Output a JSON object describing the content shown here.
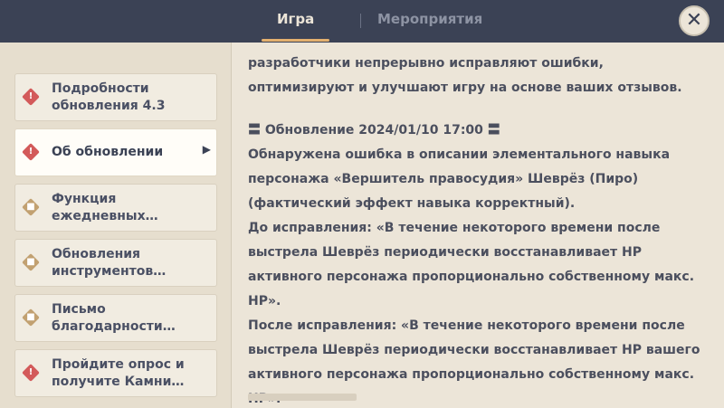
{
  "tabs": [
    {
      "label": "Игра",
      "active": true
    },
    {
      "label": "Мероприятия",
      "active": false
    }
  ],
  "close_icon": "close-icon",
  "sidebar": {
    "items": [
      {
        "label": "Подробности обновления 4.3",
        "icon": "alert-icon",
        "icon_color": "#d35a5a",
        "active": false
      },
      {
        "label": "Об обновлении",
        "icon": "alert-icon",
        "icon_color": "#d35a5a",
        "active": true
      },
      {
        "label": "Функция ежедневных…",
        "icon": "tag-icon",
        "icon_color": "#c2a171",
        "active": false
      },
      {
        "label": "Обновления инструментов…",
        "icon": "tag-icon",
        "icon_color": "#c2a171",
        "active": false
      },
      {
        "label": "Письмо благодарности…",
        "icon": "tag-icon",
        "icon_color": "#c2a171",
        "active": false
      },
      {
        "label": "Пройдите опрос и получите Камни…",
        "icon": "alert-icon",
        "icon_color": "#d35a5a",
        "active": false
      }
    ]
  },
  "content": {
    "intro": "разработчики непрерывно исправляют ошибки, оптимизируют и улучшают игру на основе ваших отзывов.",
    "heading": "〓 Обновление 2024/01/10 17:00 〓",
    "body_1": "Обнаружена ошибка в описании элементального навыка персонажа «Вершитель правосудия» Шеврёз (Пиро) (фактический эффект навыка корректный).",
    "body_2": "До исправления: «В течение некоторого времени после выстрела Шеврёз периодически восстанавливает HP активного персонажа пропорционально собственному макс. HP».",
    "body_3": "После исправления: «В течение некоторого времени после выстрела Шеврёз периодически восстанавливает HP вашего активного персонажа пропорционально собственному макс. HP»."
  }
}
